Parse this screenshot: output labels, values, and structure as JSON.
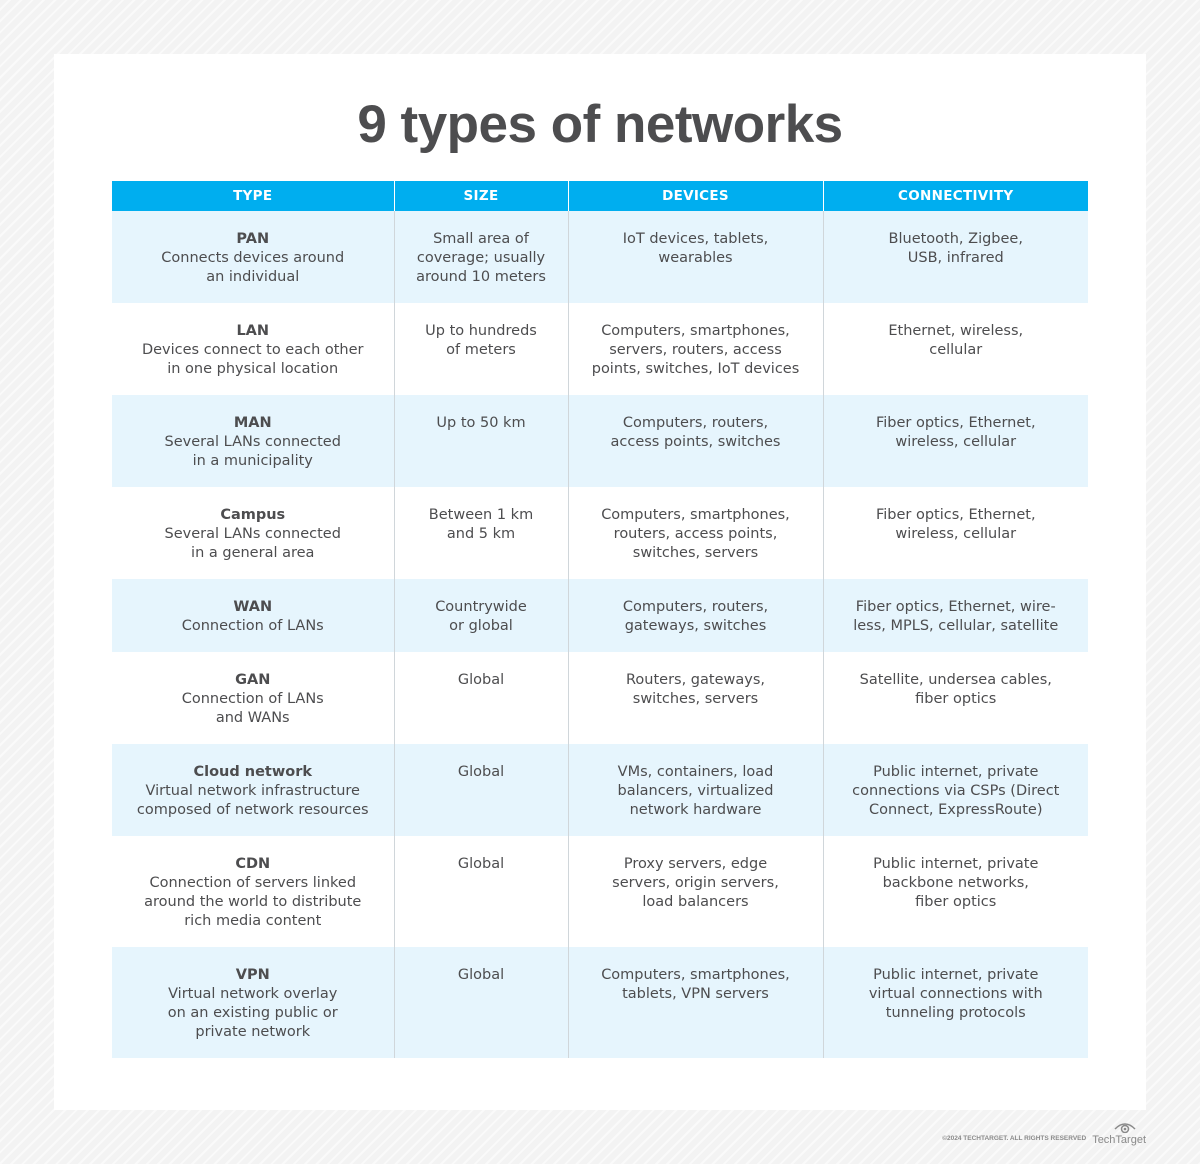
{
  "title": "9 types of networks",
  "table": {
    "headers": [
      "TYPE",
      "SIZE",
      "DEVICES",
      "CONNECTIVITY"
    ],
    "rows": [
      {
        "name": "PAN",
        "desc": "Connects devices around\nan individual",
        "size": "Small area of\ncoverage; usually\naround 10 meters",
        "devices": "IoT devices, tablets,\nwearables",
        "connectivity": "Bluetooth, Zigbee,\nUSB, infrared"
      },
      {
        "name": "LAN",
        "desc": "Devices connect to each other\nin one physical location",
        "size": "Up to hundreds\nof meters",
        "devices": "Computers, smartphones,\nservers, routers, access\npoints, switches, IoT devices",
        "connectivity": "Ethernet, wireless,\ncellular"
      },
      {
        "name": "MAN",
        "desc": "Several LANs connected\nin a municipality",
        "size": "Up to 50 km",
        "devices": "Computers, routers,\naccess points, switches",
        "connectivity": "Fiber optics, Ethernet,\nwireless, cellular"
      },
      {
        "name": "Campus",
        "desc": "Several LANs connected\nin a general area",
        "size": "Between 1 km\nand 5 km",
        "devices": "Computers, smartphones,\nrouters, access points,\nswitches, servers",
        "connectivity": "Fiber optics, Ethernet,\nwireless, cellular"
      },
      {
        "name": "WAN",
        "desc": "Connection of LANs",
        "size": "Countrywide\nor global",
        "devices": "Computers, routers,\ngateways, switches",
        "connectivity": "Fiber optics, Ethernet, wire-\nless, MPLS, cellular, satellite"
      },
      {
        "name": "GAN",
        "desc": "Connection of LANs\nand WANs",
        "size": "Global",
        "devices": "Routers, gateways,\nswitches, servers",
        "connectivity": "Satellite, undersea cables,\nfiber optics"
      },
      {
        "name": "Cloud network",
        "desc": "Virtual network infrastructure\ncomposed of network resources",
        "size": "Global",
        "devices": "VMs, containers, load\nbalancers, virtualized\nnetwork hardware",
        "connectivity": "Public internet, private\nconnections via CSPs (Direct\nConnect, ExpressRoute)"
      },
      {
        "name": "CDN",
        "desc": "Connection of servers linked\naround the world to distribute\nrich media content",
        "size": "Global",
        "devices": "Proxy servers, edge\nservers, origin servers,\nload balancers",
        "connectivity": "Public internet, private\nbackbone networks,\nfiber optics"
      },
      {
        "name": "VPN",
        "desc": "Virtual network overlay\non an existing public or\nprivate network",
        "size": "Global",
        "devices": "Computers, smartphones,\ntablets, VPN servers",
        "connectivity": "Public internet, private\nvirtual connections with\ntunneling protocols"
      }
    ]
  },
  "footer": {
    "copyright": "©2024 TECHTARGET. ALL RIGHTS RESERVED",
    "logo_text": "TechTarget",
    "logo_icon": "eye-icon"
  },
  "colors": {
    "header_bg": "#00aeef",
    "shaded_row": "#e6f5fd",
    "text": "#4d4d4f"
  }
}
